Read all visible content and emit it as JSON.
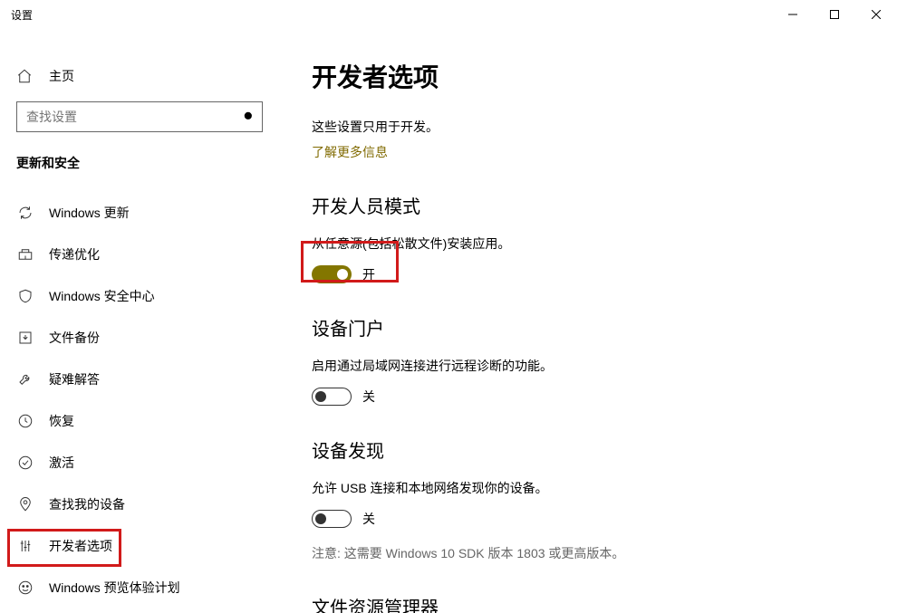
{
  "window": {
    "title": "设置"
  },
  "sidebar": {
    "home_label": "主页",
    "search_placeholder": "查找设置",
    "group_header": "更新和安全",
    "items": [
      {
        "id": "windows-update",
        "label": "Windows 更新",
        "icon": "refresh-icon"
      },
      {
        "id": "delivery-opt",
        "label": "传递优化",
        "icon": "delivery-icon"
      },
      {
        "id": "windows-security",
        "label": "Windows 安全中心",
        "icon": "shield-icon"
      },
      {
        "id": "backup",
        "label": "文件备份",
        "icon": "backup-icon"
      },
      {
        "id": "troubleshoot",
        "label": "疑难解答",
        "icon": "wrench-icon"
      },
      {
        "id": "recovery",
        "label": "恢复",
        "icon": "recovery-icon"
      },
      {
        "id": "activation",
        "label": "激活",
        "icon": "check-circle-icon"
      },
      {
        "id": "find-device",
        "label": "查找我的设备",
        "icon": "location-icon"
      },
      {
        "id": "developer",
        "label": "开发者选项",
        "icon": "developer-icon",
        "selected": true
      },
      {
        "id": "insider",
        "label": "Windows 预览体验计划",
        "icon": "insider-icon"
      }
    ]
  },
  "main": {
    "title": "开发者选项",
    "desc": "这些设置只用于开发。",
    "link": "了解更多信息",
    "sections": {
      "dev_mode": {
        "title": "开发人员模式",
        "sub": "从任意源(包括松散文件)安装应用。",
        "toggle_state": "on",
        "toggle_label": "开"
      },
      "device_portal": {
        "title": "设备门户",
        "sub": "启用通过局域网连接进行远程诊断的功能。",
        "toggle_state": "off",
        "toggle_label": "关"
      },
      "device_discovery": {
        "title": "设备发现",
        "sub": "允许 USB 连接和本地网络发现你的设备。",
        "toggle_state": "off",
        "toggle_label": "关",
        "note": "注意: 这需要 Windows 10 SDK 版本 1803 或更高版本。"
      },
      "explorer": {
        "title": "文件资源管理器"
      }
    }
  },
  "colors": {
    "accent": "#837600",
    "link": "#806a00",
    "highlight_border": "#d11a1a"
  }
}
